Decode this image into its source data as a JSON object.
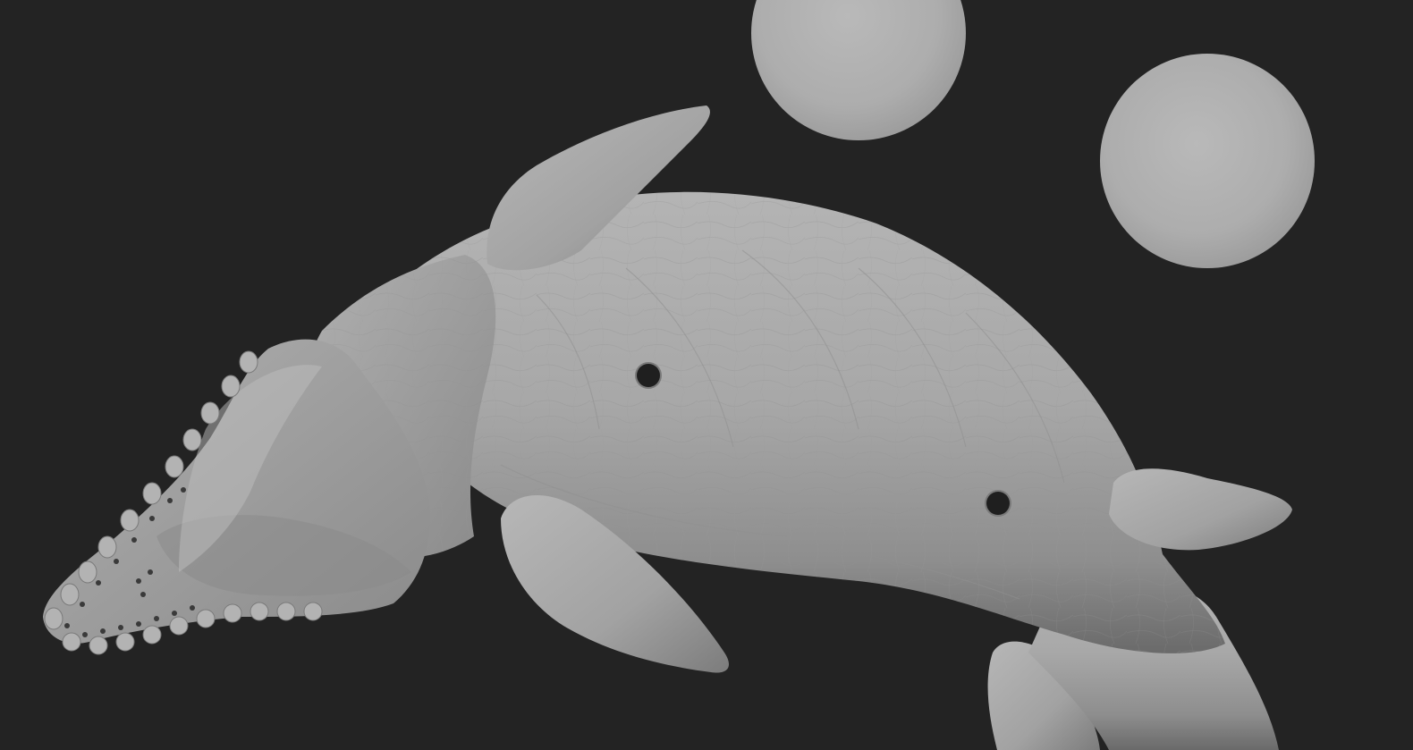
{
  "scene": {
    "background_color": "#232323",
    "clay_color": "#a9a9a9",
    "subject": "sculpted-creature",
    "objects": [
      "sphere-top",
      "sphere-right",
      "creature-body",
      "creature-dorsal-fin",
      "creature-pectoral-fin",
      "creature-pelvic-fin",
      "creature-rear-fin",
      "creature-head",
      "creature-tail"
    ]
  }
}
